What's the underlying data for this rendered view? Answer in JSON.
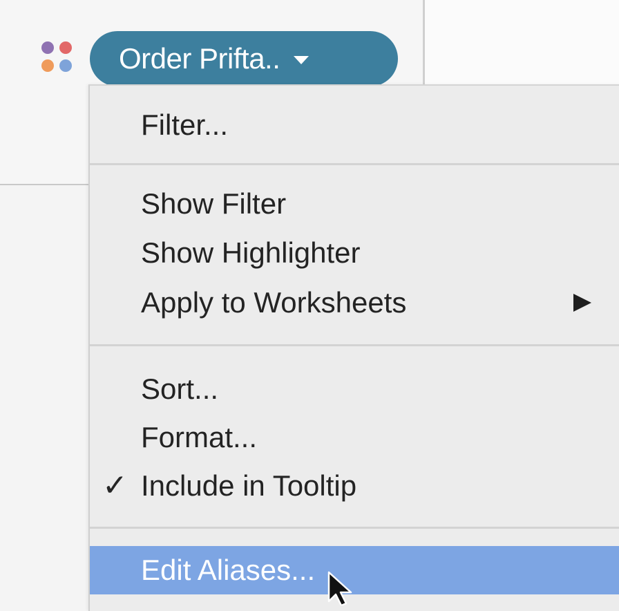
{
  "pill": {
    "label": "Order Prifta..",
    "color": "#3d7f9e"
  },
  "field_type_icon": {
    "name": "discrete-dimension-icon",
    "dot_colors": [
      "#8f72b2",
      "#e26868",
      "#ef9b5b",
      "#7ea3d9"
    ]
  },
  "menu": {
    "items": [
      {
        "label": "Filter..."
      },
      {
        "label": "Show Filter"
      },
      {
        "label": "Show Highlighter"
      },
      {
        "label": "Apply to Worksheets"
      },
      {
        "label": "Sort..."
      },
      {
        "label": "Format..."
      },
      {
        "label": "Include in Tooltip",
        "checked": true
      },
      {
        "label": "Edit Aliases...",
        "highlighted": true
      }
    ],
    "check_mark": "✓",
    "highlight_color": "#7da5e3"
  }
}
